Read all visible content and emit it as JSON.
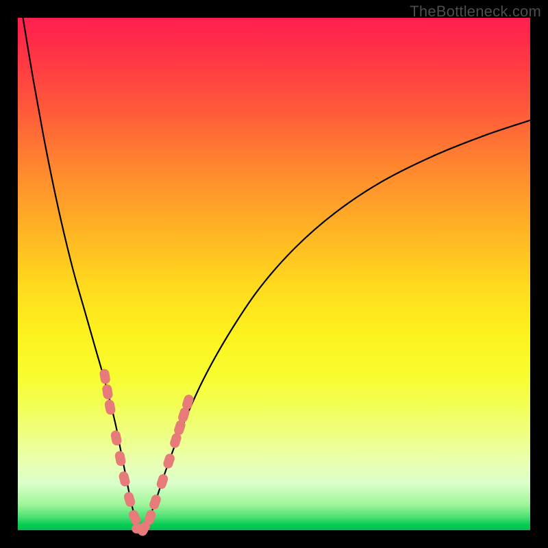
{
  "watermark": "TheBottleneck.com",
  "colors": {
    "frame": "#000000",
    "curve": "#000000",
    "marker_fill": "#e77b79",
    "marker_stroke": "#c95a58"
  },
  "chart_data": {
    "type": "line",
    "title": "",
    "xlabel": "",
    "ylabel": "",
    "xlim": [
      0,
      100
    ],
    "ylim": [
      0,
      100
    ],
    "note": "Values estimated from pixel positions; no numeric axes are shown in the source image.",
    "series": [
      {
        "name": "bottleneck-curve",
        "x": [
          1,
          3,
          5,
          7,
          9,
          11,
          13,
          15,
          17,
          19,
          20,
          21,
          22,
          23,
          23.7,
          24.5,
          25.5,
          27,
          29,
          32,
          36,
          41,
          47,
          54,
          62,
          71,
          81,
          91,
          100
        ],
        "y": [
          100,
          88,
          77,
          67,
          58,
          50,
          43,
          36,
          29,
          21,
          16,
          11,
          6,
          2,
          0,
          0,
          2,
          6,
          12,
          20,
          29,
          38,
          47,
          55,
          62,
          68,
          73,
          77,
          80
        ]
      }
    ],
    "markers": [
      {
        "x": 17.0,
        "y": 30
      },
      {
        "x": 17.5,
        "y": 27
      },
      {
        "x": 18.0,
        "y": 24
      },
      {
        "x": 19.2,
        "y": 18
      },
      {
        "x": 20.0,
        "y": 14
      },
      {
        "x": 20.8,
        "y": 10
      },
      {
        "x": 21.8,
        "y": 6
      },
      {
        "x": 22.8,
        "y": 2.5
      },
      {
        "x": 23.7,
        "y": 0.3
      },
      {
        "x": 24.6,
        "y": 0.3
      },
      {
        "x": 25.8,
        "y": 2.5
      },
      {
        "x": 26.8,
        "y": 5.5
      },
      {
        "x": 28.2,
        "y": 9.5
      },
      {
        "x": 29.5,
        "y": 13.5
      },
      {
        "x": 30.8,
        "y": 17.5
      },
      {
        "x": 31.6,
        "y": 20
      },
      {
        "x": 32.4,
        "y": 22.5
      },
      {
        "x": 33.2,
        "y": 25
      }
    ]
  }
}
